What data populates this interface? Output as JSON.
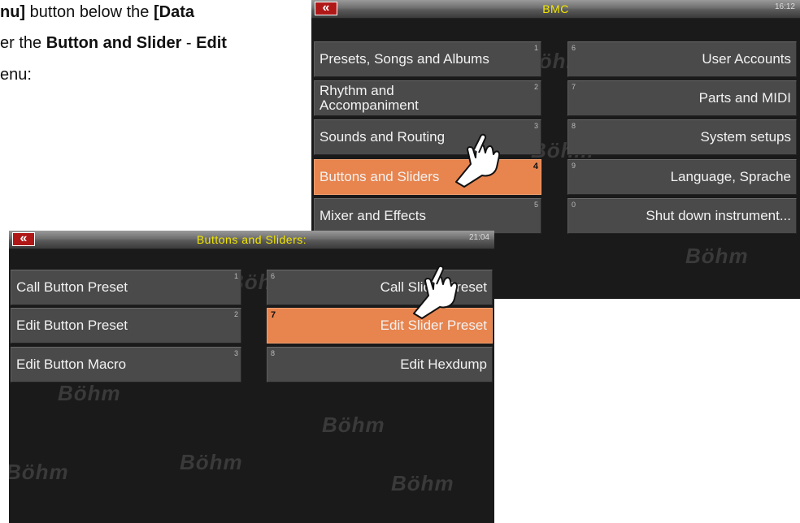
{
  "doc": {
    "line1": [
      {
        "text": "nu]",
        "bold": true
      },
      {
        "text": " button below the ",
        "bold": false
      },
      {
        "text": "[Data",
        "bold": true
      }
    ],
    "line2": [
      {
        "text": "er the ",
        "bold": false
      },
      {
        "text": "Button and Slider",
        "bold": true
      },
      {
        "text": " - ",
        "bold": false
      },
      {
        "text": "Edit",
        "bold": true
      }
    ],
    "line3": [
      {
        "text": "enu:",
        "bold": false
      }
    ]
  },
  "screen_bmc": {
    "back_label": "«",
    "title": "BMC",
    "clock": "16:12",
    "left_buttons": [
      {
        "label": "Presets, Songs and Albums",
        "num": "1",
        "active": false
      },
      {
        "label": "Rhythm and Accompaniment",
        "num": "2",
        "active": false
      },
      {
        "label": "Sounds and Routing",
        "num": "3",
        "active": false
      },
      {
        "label": "Buttons and Sliders",
        "num": "4",
        "active": true
      },
      {
        "label": "Mixer and Effects",
        "num": "5",
        "active": false
      }
    ],
    "right_buttons": [
      {
        "label": "User Accounts",
        "num": "6",
        "active": false
      },
      {
        "label": "Parts and MIDI",
        "num": "7",
        "active": false
      },
      {
        "label": "System setups",
        "num": "8",
        "active": false
      },
      {
        "label": "Language, Sprache",
        "num": "9",
        "active": false
      },
      {
        "label": "Shut down instrument...",
        "num": "0",
        "active": false
      }
    ],
    "watermark": "Böhm"
  },
  "screen_bs": {
    "back_label": "«",
    "title": "Buttons and Sliders:",
    "clock": "21:04",
    "left_buttons": [
      {
        "label": "Call Button Preset",
        "num": "1",
        "active": false
      },
      {
        "label": "Edit Button Preset",
        "num": "2",
        "active": false
      },
      {
        "label": "Edit Button Macro",
        "num": "3",
        "active": false
      }
    ],
    "right_buttons": [
      {
        "label": "Call Slider Preset",
        "num": "6",
        "active": false
      },
      {
        "label": "Edit Slider Preset",
        "num": "7",
        "active": true
      },
      {
        "label": "Edit Hexdump",
        "num": "8",
        "active": false
      }
    ],
    "watermark": "Böhm"
  },
  "colors": {
    "active_button": "#e8844e",
    "button": "#4a4a4a",
    "title_text": "#f2e600",
    "back_button": "#b01818"
  },
  "icons": [
    "back-icon",
    "pointing-hand-icon"
  ]
}
